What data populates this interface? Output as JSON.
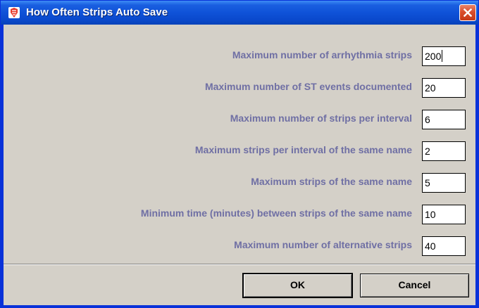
{
  "window": {
    "title": "How Often Strips Auto Save",
    "app_icon": "java-app-icon",
    "close_icon": "close-icon",
    "colors": {
      "titlebar": "#0a49cc",
      "client": "#d4d0c8",
      "label": "#6f6fa4",
      "close": "#d94e2c"
    }
  },
  "settings": [
    {
      "label": "Maximum number of arrhythmia strips",
      "value": "200"
    },
    {
      "label": "Maximum number of ST events documented",
      "value": "20"
    },
    {
      "label": "Maximum number of strips per interval",
      "value": "6"
    },
    {
      "label": "Maximum strips per interval of the same name",
      "value": "2"
    },
    {
      "label": "Maximum strips of the same name",
      "value": "5"
    },
    {
      "label": "Minimum time (minutes) between strips of the same name",
      "value": "10"
    },
    {
      "label": "Maximum number of alternative strips",
      "value": "40"
    }
  ],
  "buttons": {
    "ok": "OK",
    "cancel": "Cancel"
  }
}
